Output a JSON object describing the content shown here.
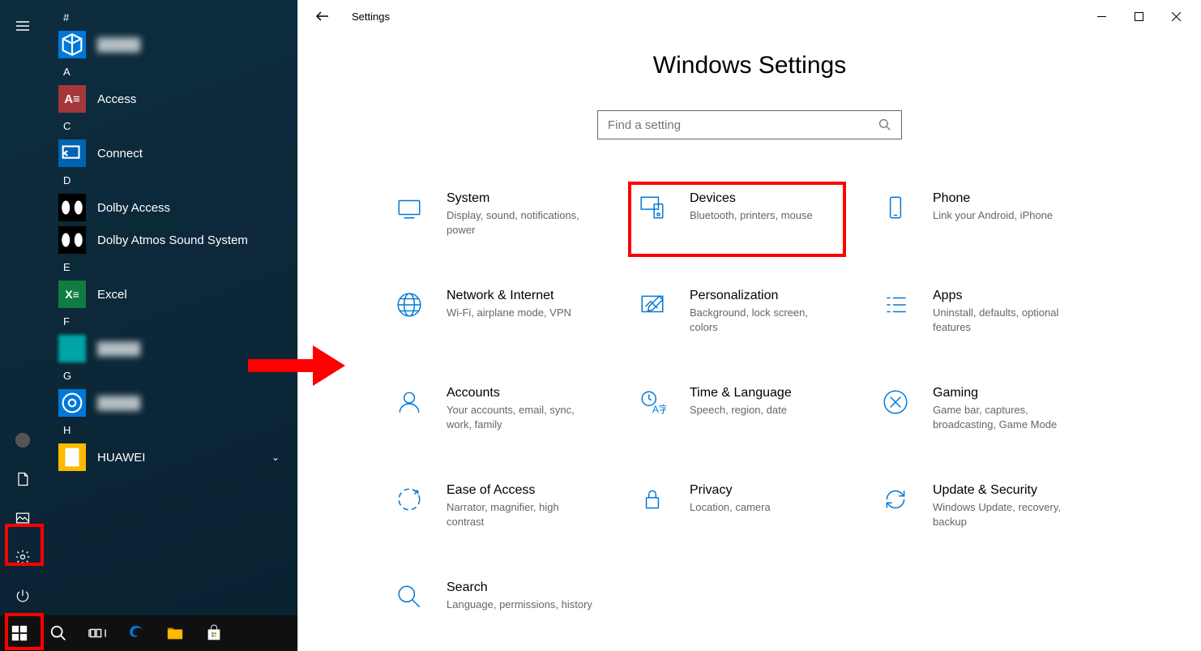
{
  "window_title": "Settings",
  "settings_heading": "Windows Settings",
  "search_placeholder": "Find a setting",
  "start_menu": {
    "sections": [
      {
        "letter": "#",
        "items": [
          {
            "name": "",
            "icon": "3d",
            "blurred": true
          }
        ]
      },
      {
        "letter": "A",
        "items": [
          {
            "name": "Access",
            "icon": "access"
          }
        ]
      },
      {
        "letter": "C",
        "items": [
          {
            "name": "Connect",
            "icon": "connect"
          }
        ]
      },
      {
        "letter": "D",
        "items": [
          {
            "name": "Dolby Access",
            "icon": "dolby"
          },
          {
            "name": "Dolby Atmos Sound System",
            "icon": "dolby"
          }
        ]
      },
      {
        "letter": "E",
        "items": [
          {
            "name": "Excel",
            "icon": "excel"
          }
        ]
      },
      {
        "letter": "F",
        "items": [
          {
            "name": "",
            "icon": "blur1",
            "blurred": true
          }
        ]
      },
      {
        "letter": "G",
        "items": [
          {
            "name": "",
            "icon": "blur2",
            "blurred": true
          }
        ]
      },
      {
        "letter": "H",
        "items": [
          {
            "name": "HUAWEI",
            "icon": "huawei",
            "expandable": true
          }
        ]
      }
    ]
  },
  "settings_categories": [
    {
      "title": "System",
      "desc": "Display, sound, notifications, power",
      "icon": "system"
    },
    {
      "title": "Devices",
      "desc": "Bluetooth, printers, mouse",
      "icon": "devices",
      "highlighted": true
    },
    {
      "title": "Phone",
      "desc": "Link your Android, iPhone",
      "icon": "phone"
    },
    {
      "title": "Network & Internet",
      "desc": "Wi-Fi, airplane mode, VPN",
      "icon": "network"
    },
    {
      "title": "Personalization",
      "desc": "Background, lock screen, colors",
      "icon": "personalization"
    },
    {
      "title": "Apps",
      "desc": "Uninstall, defaults, optional features",
      "icon": "apps"
    },
    {
      "title": "Accounts",
      "desc": "Your accounts, email, sync, work, family",
      "icon": "accounts"
    },
    {
      "title": "Time & Language",
      "desc": "Speech, region, date",
      "icon": "time"
    },
    {
      "title": "Gaming",
      "desc": "Game bar, captures, broadcasting, Game Mode",
      "icon": "gaming"
    },
    {
      "title": "Ease of Access",
      "desc": "Narrator, magnifier, high contrast",
      "icon": "ease"
    },
    {
      "title": "Privacy",
      "desc": "Location, camera",
      "icon": "privacy"
    },
    {
      "title": "Update & Security",
      "desc": "Windows Update, recovery, backup",
      "icon": "update"
    },
    {
      "title": "Search",
      "desc": "Language, permissions, history",
      "icon": "search"
    }
  ]
}
